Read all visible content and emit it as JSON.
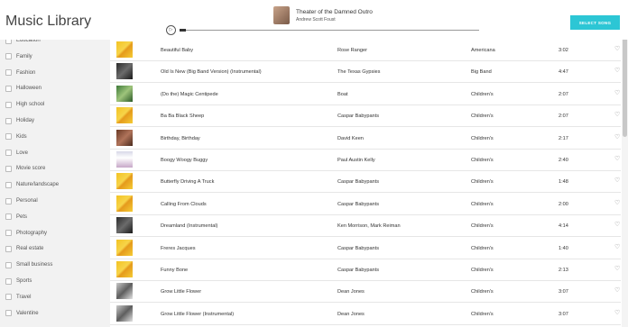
{
  "app": {
    "title": "Music Library"
  },
  "player": {
    "track_title": "Theater of the Damned Outro",
    "track_artist": "Andrew Scott Foust",
    "play_icon": "▷",
    "progress_fraction": 0.02
  },
  "header": {
    "select_label": "SELECT SONG"
  },
  "colors": {
    "accent": "#2cc6d5",
    "sidebar_bg": "#f2f2f2"
  },
  "sidebar": {
    "items": [
      {
        "label": "Education"
      },
      {
        "label": "Family"
      },
      {
        "label": "Fashion"
      },
      {
        "label": "Halloween"
      },
      {
        "label": "High school"
      },
      {
        "label": "Holiday"
      },
      {
        "label": "Kids"
      },
      {
        "label": "Love"
      },
      {
        "label": "Movie score"
      },
      {
        "label": "Nature/landscape"
      },
      {
        "label": "Personal"
      },
      {
        "label": "Pets"
      },
      {
        "label": "Photography"
      },
      {
        "label": "Real estate"
      },
      {
        "label": "Small business"
      },
      {
        "label": "Sports"
      },
      {
        "label": "Travel"
      },
      {
        "label": "Valentine"
      }
    ]
  },
  "songs": [
    {
      "title": "Beautiful Baby",
      "artist": "Rose Ranger",
      "genre": "Americana",
      "duration": "3:02",
      "art": "yellow"
    },
    {
      "title": "Old Is New (Big Band Version) (Instrumental)",
      "artist": "The Texas Gypsies",
      "genre": "Big Band",
      "duration": "4:47",
      "art": "dark"
    },
    {
      "title": "(Do the) Magic Centipede",
      "artist": "Boat",
      "genre": "Children's",
      "duration": "2:07",
      "art": "green"
    },
    {
      "title": "Ba Ba Black Sheep",
      "artist": "Caspar Babypants",
      "genre": "Children's",
      "duration": "2:07",
      "art": "yellow"
    },
    {
      "title": "Birthday, Birthday",
      "artist": "David Keen",
      "genre": "Children's",
      "duration": "2:17",
      "art": "brown"
    },
    {
      "title": "Boogy Woogy Buggy",
      "artist": "Paul Austin Kelly",
      "genre": "Children's",
      "duration": "2:40",
      "art": "light"
    },
    {
      "title": "Butterfly Driving A Truck",
      "artist": "Caspar Babypants",
      "genre": "Children's",
      "duration": "1:48",
      "art": "yellow"
    },
    {
      "title": "Calling From Clouds",
      "artist": "Caspar Babypants",
      "genre": "Children's",
      "duration": "2:00",
      "art": "yellow"
    },
    {
      "title": "Dreamland (Instrumental)",
      "artist": "Ken Morrison, Mark Reiman",
      "genre": "Children's",
      "duration": "4:14",
      "art": "dark"
    },
    {
      "title": "Freres Jacques",
      "artist": "Caspar Babypants",
      "genre": "Children's",
      "duration": "1:40",
      "art": "yellow"
    },
    {
      "title": "Funny Bone",
      "artist": "Caspar Babypants",
      "genre": "Children's",
      "duration": "2:13",
      "art": "yellow"
    },
    {
      "title": "Grow Little Flower",
      "artist": "Dean Jones",
      "genre": "Children's",
      "duration": "3:07",
      "art": "gray"
    },
    {
      "title": "Grow Little Flower (Instrumental)",
      "artist": "Dean Jones",
      "genre": "Children's",
      "duration": "3:07",
      "art": "gray"
    }
  ]
}
